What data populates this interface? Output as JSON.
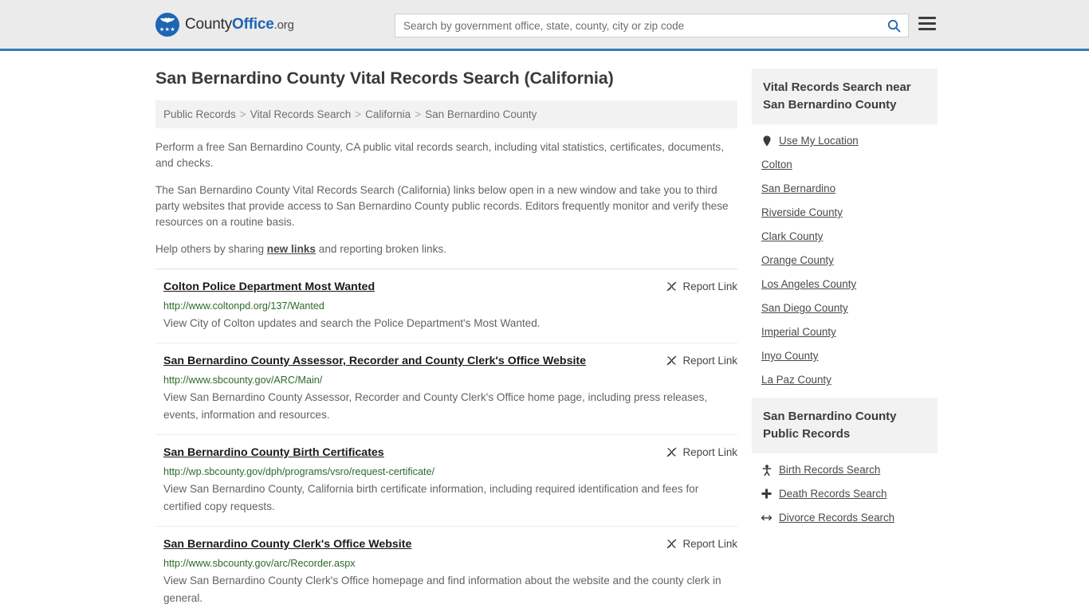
{
  "header": {
    "logo": {
      "text_county": "County",
      "text_office": "Office",
      "text_domain": ".org",
      "stars": "★★★"
    },
    "search": {
      "placeholder": "Search by government office, state, county, city or zip code",
      "value": "",
      "search_icon": "search-icon"
    },
    "menu_icon": "hamburger-menu-icon",
    "accent_color": "#3a7ab5",
    "background_color": "#ebebeb"
  },
  "main": {
    "page_title": "San Bernardino County Vital Records Search (California)",
    "breadcrumb": [
      "Public Records",
      "Vital Records Search",
      "California",
      "San Bernardino County"
    ],
    "breadcrumb_separator": ">",
    "intro_paragraphs": [
      "Perform a free San Bernardino County, CA public vital records search, including vital statistics, certificates, documents, and checks.",
      "The San Bernardino County Vital Records Search (California) links below open in a new window and take you to third party websites that provide access to San Bernardino County public records. Editors frequently monitor and verify these resources on a routine basis."
    ],
    "help_line": {
      "before": "Help others by sharing ",
      "link": "new links",
      "after": " and reporting broken links."
    },
    "report_link_label": "Report Link",
    "report_link_icon": "broken-link-icon",
    "results": [
      {
        "title": "Colton Police Department Most Wanted",
        "url": "http://www.coltonpd.org/137/Wanted",
        "description": "View City of Colton updates and search the Police Department's Most Wanted."
      },
      {
        "title": "San Bernardino County Assessor, Recorder and County Clerk's Office Website",
        "url": "http://www.sbcounty.gov/ARC/Main/",
        "description": "View San Bernardino County Assessor, Recorder and County Clerk's Office home page, including press releases, events, information and resources."
      },
      {
        "title": "San Bernardino County Birth Certificates",
        "url": "http://wp.sbcounty.gov/dph/programs/vsro/request-certificate/",
        "description": "View San Bernardino County, California birth certificate information, including required identification and fees for certified copy requests."
      },
      {
        "title": "San Bernardino County Clerk's Office Website",
        "url": "http://www.sbcounty.gov/arc/Recorder.aspx",
        "description": "View San Bernardino County Clerk's Office homepage and find information about the website and the county clerk in general."
      }
    ]
  },
  "sidebar": {
    "nearby": {
      "heading": "Vital Records Search near San Bernardino County",
      "items": [
        {
          "label": "Use My Location",
          "icon": "map-pin-icon"
        },
        {
          "label": "Colton",
          "icon": ""
        },
        {
          "label": "San Bernardino",
          "icon": ""
        },
        {
          "label": "Riverside County",
          "icon": ""
        },
        {
          "label": "Clark County",
          "icon": ""
        },
        {
          "label": "Orange County",
          "icon": ""
        },
        {
          "label": "Los Angeles County",
          "icon": ""
        },
        {
          "label": "San Diego County",
          "icon": ""
        },
        {
          "label": "Imperial County",
          "icon": ""
        },
        {
          "label": "Inyo County",
          "icon": ""
        },
        {
          "label": "La Paz County",
          "icon": ""
        }
      ]
    },
    "public_records": {
      "heading": "San Bernardino County Public Records",
      "items": [
        {
          "label": "Birth Records Search",
          "icon": "baby-icon"
        },
        {
          "label": "Death Records Search",
          "icon": "cross-icon"
        },
        {
          "label": "Divorce Records Search",
          "icon": "split-arrows-icon"
        }
      ]
    }
  }
}
